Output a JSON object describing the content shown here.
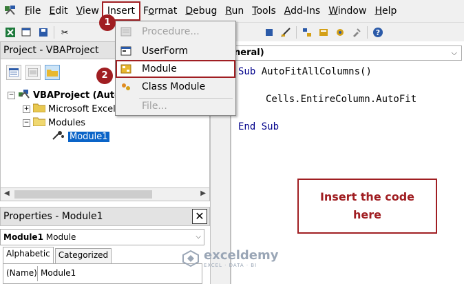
{
  "menubar": {
    "items": [
      {
        "pre": "",
        "ul": "F",
        "post": "ile"
      },
      {
        "pre": "",
        "ul": "E",
        "post": "dit"
      },
      {
        "pre": "",
        "ul": "V",
        "post": "iew"
      },
      {
        "pre": "",
        "ul": "I",
        "post": "nsert"
      },
      {
        "pre": "F",
        "ul": "o",
        "post": "rmat"
      },
      {
        "pre": "",
        "ul": "D",
        "post": "ebug"
      },
      {
        "pre": "",
        "ul": "R",
        "post": "un"
      },
      {
        "pre": "",
        "ul": "T",
        "post": "ools"
      },
      {
        "pre": "",
        "ul": "A",
        "post": "dd-Ins"
      },
      {
        "pre": "",
        "ul": "W",
        "post": "indow"
      },
      {
        "pre": "",
        "ul": "H",
        "post": "elp"
      }
    ]
  },
  "insert_menu": {
    "procedure": "Procedure...",
    "userform": "UserForm",
    "module": "Module",
    "class_module": "Class Module",
    "file": "File..."
  },
  "badges": {
    "first": "1",
    "second": "2"
  },
  "project": {
    "title": "Project - VBAProject",
    "tree": {
      "root": "VBAProject (Auto",
      "excel_objects": "Microsoft Excel",
      "modules": "Modules",
      "module1": "Module1"
    }
  },
  "properties": {
    "title": "Properties - Module1",
    "object_name": "Module1",
    "object_type": "Module",
    "tab_alphabetic": "Alphabetic",
    "tab_categorized": "Categorized",
    "row_key": "(Name)",
    "row_value": "Module1"
  },
  "code": {
    "combo_value": "neral)",
    "sub_kw": "Sub",
    "sub_name": " AutoFitAllColumns()",
    "body": "Cells.EntireColumn.AutoFit",
    "end_kw": "End Sub"
  },
  "callout": {
    "text": "Insert the code here"
  },
  "watermark": {
    "name": "exceldemy",
    "tagline": "EXCEL · DATA · BI"
  },
  "colors": {
    "accent": "#a01e22",
    "selection": "#0a64c8",
    "keyword": "#00008b"
  }
}
